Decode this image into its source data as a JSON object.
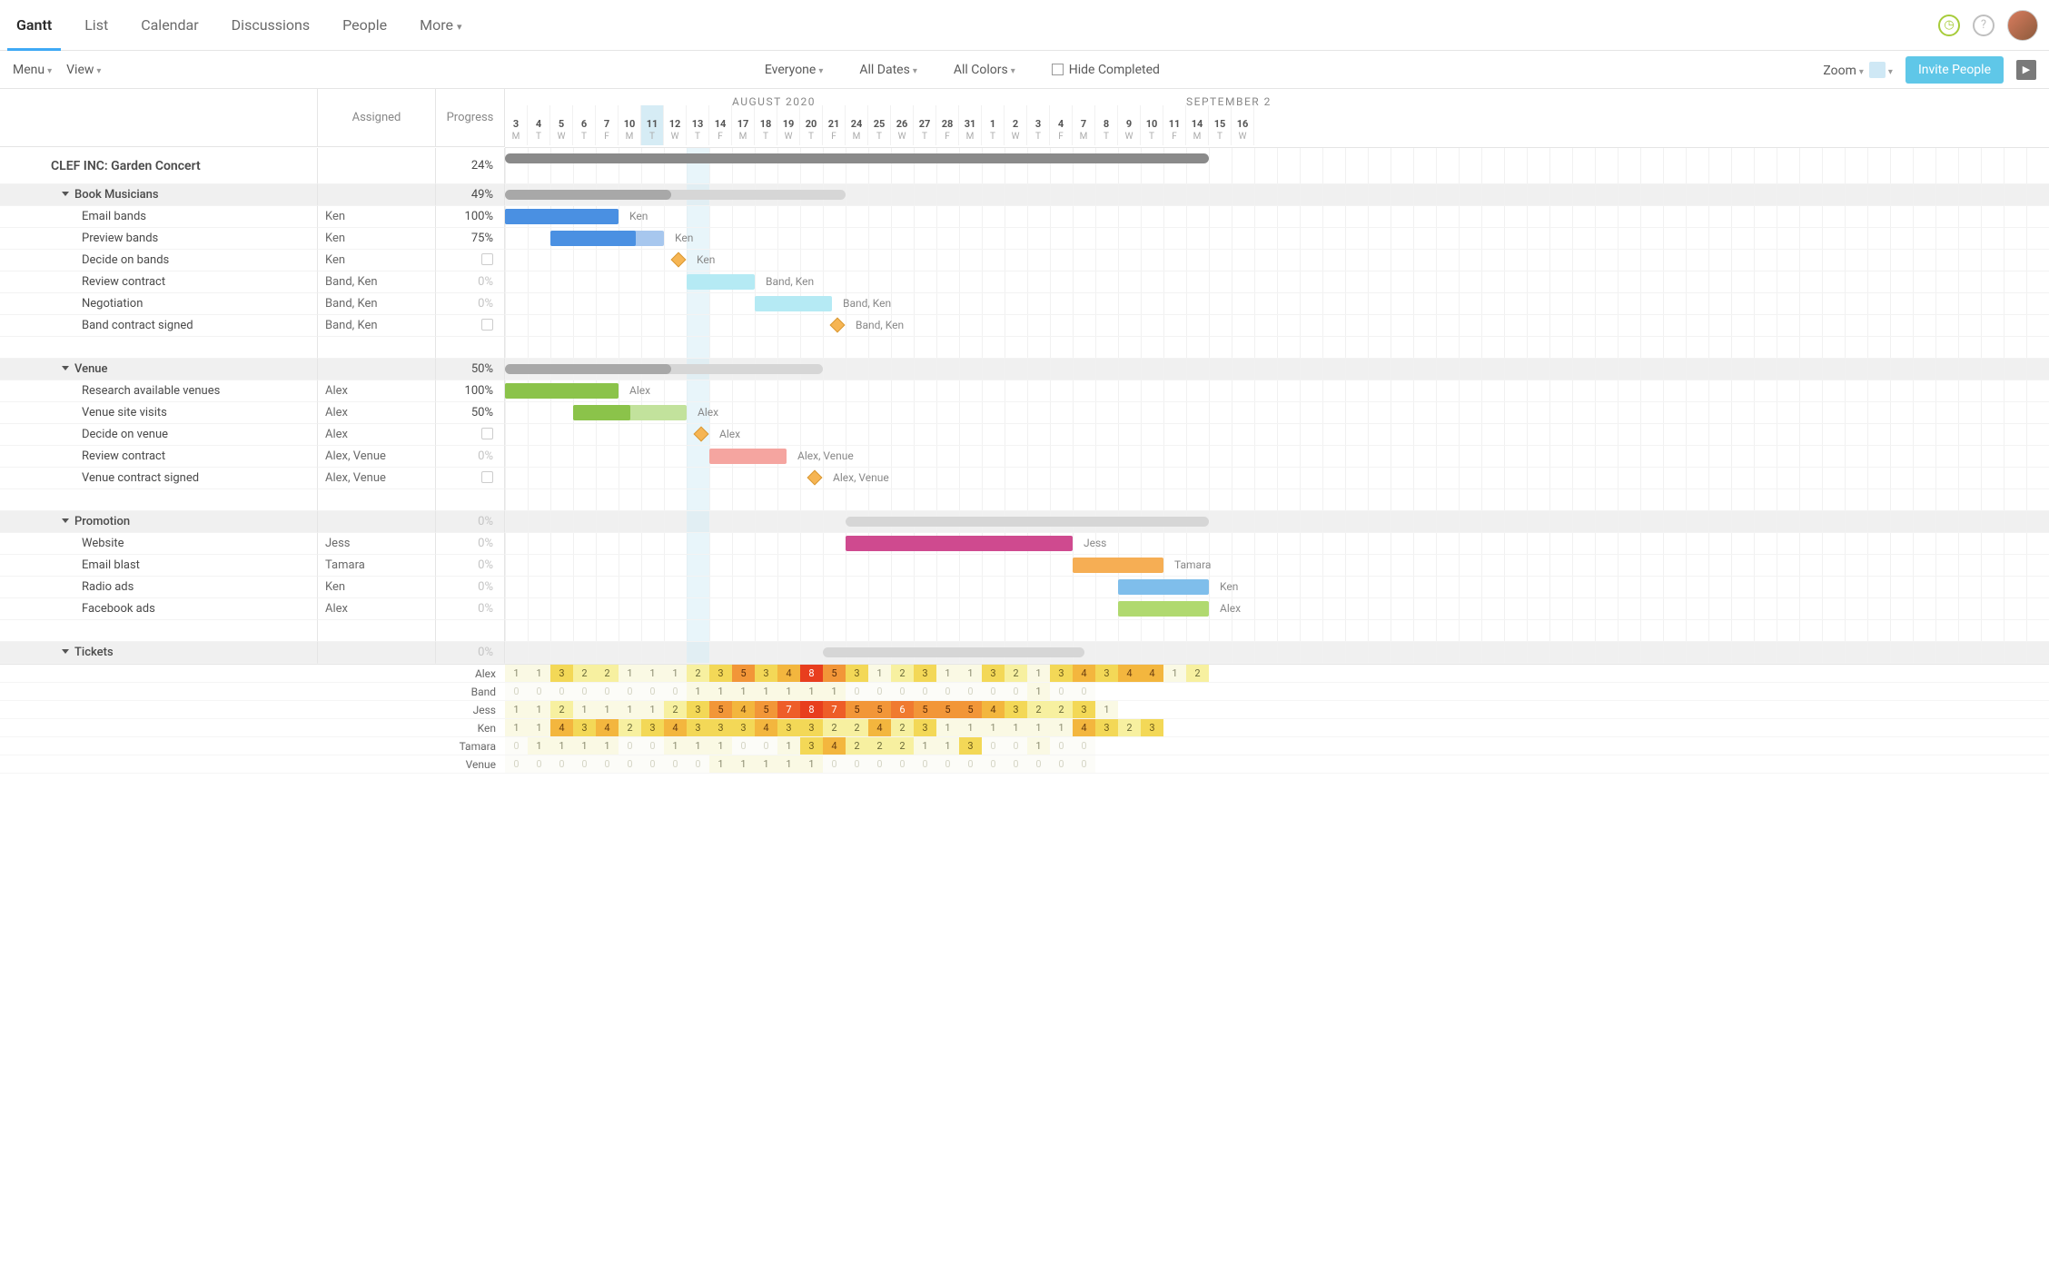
{
  "nav": {
    "tabs": [
      "Gantt",
      "List",
      "Calendar",
      "Discussions",
      "People",
      "More"
    ],
    "active": 0
  },
  "toolbar": {
    "menu": "Menu",
    "view": "View",
    "filters": {
      "people": "Everyone",
      "dates": "All Dates",
      "colors": "All Colors",
      "hide": "Hide Completed"
    },
    "zoom": "Zoom",
    "invite": "Invite People"
  },
  "columns": {
    "assigned": "Assigned",
    "progress": "Progress"
  },
  "timeline": {
    "month1": "AUGUST 2020",
    "month2": "SEPTEMBER 2",
    "start": 3,
    "today": 11,
    "days": [
      {
        "n": 3,
        "d": "M"
      },
      {
        "n": 4,
        "d": "T"
      },
      {
        "n": 5,
        "d": "W"
      },
      {
        "n": 6,
        "d": "T"
      },
      {
        "n": 7,
        "d": "F"
      },
      {
        "n": 10,
        "d": "M"
      },
      {
        "n": 11,
        "d": "T"
      },
      {
        "n": 12,
        "d": "W"
      },
      {
        "n": 13,
        "d": "T"
      },
      {
        "n": 14,
        "d": "F"
      },
      {
        "n": 17,
        "d": "M"
      },
      {
        "n": 18,
        "d": "T"
      },
      {
        "n": 19,
        "d": "W"
      },
      {
        "n": 20,
        "d": "T"
      },
      {
        "n": 21,
        "d": "F"
      },
      {
        "n": 24,
        "d": "M"
      },
      {
        "n": 25,
        "d": "T"
      },
      {
        "n": 26,
        "d": "W"
      },
      {
        "n": 27,
        "d": "T"
      },
      {
        "n": 28,
        "d": "F"
      },
      {
        "n": 31,
        "d": "M"
      },
      {
        "n": 1,
        "d": "T"
      },
      {
        "n": 2,
        "d": "W"
      },
      {
        "n": 3,
        "d": "T"
      },
      {
        "n": 4,
        "d": "F"
      },
      {
        "n": 7,
        "d": "M"
      },
      {
        "n": 8,
        "d": "T"
      },
      {
        "n": 9,
        "d": "W"
      },
      {
        "n": 10,
        "d": "T"
      },
      {
        "n": 11,
        "d": "F"
      },
      {
        "n": 14,
        "d": "M"
      },
      {
        "n": 15,
        "d": "T"
      },
      {
        "n": 16,
        "d": "W"
      }
    ]
  },
  "project": {
    "name": "CLEF INC: Garden Concert",
    "progress": "24%"
  },
  "groups": [
    {
      "name": "Book Musicians",
      "progress": "49%",
      "summary": {
        "start": 0,
        "len": 15,
        "done": 7.3
      },
      "tasks": [
        {
          "name": "Email bands",
          "assigned": "Ken",
          "progress": "100%",
          "bar": {
            "start": 0,
            "len": 5,
            "color": "blue",
            "done": 5
          },
          "label": "Ken"
        },
        {
          "name": "Preview bands",
          "assigned": "Ken",
          "progress": "75%",
          "bar": {
            "start": 2,
            "len": 5,
            "color": "blue",
            "done": 3.75
          },
          "label": "Ken"
        },
        {
          "name": "Decide on bands",
          "assigned": "Ken",
          "progress": "box",
          "milestone": {
            "at": 7.4
          },
          "label": "Ken"
        },
        {
          "name": "Review contract",
          "assigned": "Band, Ken",
          "progress": "0%",
          "muted": true,
          "bar": {
            "start": 8,
            "len": 3,
            "color": "cyan"
          },
          "label": "Band, Ken"
        },
        {
          "name": "Negotiation",
          "assigned": "Band, Ken",
          "progress": "0%",
          "muted": true,
          "bar": {
            "start": 11,
            "len": 3.4,
            "color": "cyan"
          },
          "label": "Band, Ken"
        },
        {
          "name": "Band contract signed",
          "assigned": "Band, Ken",
          "progress": "box",
          "milestone": {
            "at": 14.4
          },
          "label": "Band, Ken"
        }
      ]
    },
    {
      "name": "Venue",
      "progress": "50%",
      "summary": {
        "start": 0,
        "len": 14,
        "done": 7.3
      },
      "tasks": [
        {
          "name": "Research available venues",
          "assigned": "Alex",
          "progress": "100%",
          "bar": {
            "start": 0,
            "len": 5,
            "color": "green",
            "done": 5
          },
          "label": "Alex"
        },
        {
          "name": "Venue site visits",
          "assigned": "Alex",
          "progress": "50%",
          "bar": {
            "start": 3,
            "len": 5,
            "color": "green",
            "done": 2.5
          },
          "label": "Alex"
        },
        {
          "name": "Decide on venue",
          "assigned": "Alex",
          "progress": "box",
          "milestone": {
            "at": 8.4
          },
          "label": "Alex"
        },
        {
          "name": "Review contract",
          "assigned": "Alex, Venue",
          "progress": "0%",
          "muted": true,
          "bar": {
            "start": 9,
            "len": 3.4,
            "color": "red"
          },
          "label": "Alex, Venue"
        },
        {
          "name": "Venue contract signed",
          "assigned": "Alex, Venue",
          "progress": "box",
          "milestone": {
            "at": 13.4
          },
          "label": "Alex, Venue"
        }
      ]
    },
    {
      "name": "Promotion",
      "progress": "0%",
      "muted": true,
      "summary": {
        "start": 15,
        "len": 16,
        "done": 0
      },
      "tasks": [
        {
          "name": "Website",
          "assigned": "Jess",
          "progress": "0%",
          "muted": true,
          "bar": {
            "start": 15,
            "len": 10,
            "color": "pink"
          },
          "label": "Jess"
        },
        {
          "name": "Email blast",
          "assigned": "Tamara",
          "progress": "0%",
          "muted": true,
          "bar": {
            "start": 25,
            "len": 4,
            "color": "orange"
          },
          "label": "Tamara"
        },
        {
          "name": "Radio ads",
          "assigned": "Ken",
          "progress": "0%",
          "muted": true,
          "bar": {
            "start": 27,
            "len": 4,
            "color": "skyblue"
          },
          "label": "Ken"
        },
        {
          "name": "Facebook ads",
          "assigned": "Alex",
          "progress": "0%",
          "muted": true,
          "bar": {
            "start": 27,
            "len": 4,
            "color": "lime"
          },
          "label": "Alex"
        }
      ]
    },
    {
      "name": "Tickets",
      "progress": "0%",
      "muted": true,
      "summary": {
        "start": 14,
        "len": 11.5,
        "done": 0
      },
      "tasks": []
    }
  ],
  "workload": {
    "people": [
      "Alex",
      "Band",
      "Jess",
      "Ken",
      "Tamara",
      "Venue"
    ],
    "rows": [
      [
        1,
        1,
        3,
        2,
        2,
        1,
        1,
        1,
        2,
        3,
        5,
        3,
        4,
        8,
        5,
        3,
        1,
        2,
        3,
        1,
        1,
        3,
        2,
        1,
        3,
        4,
        3,
        4,
        4,
        1,
        2
      ],
      [
        0,
        0,
        0,
        0,
        0,
        0,
        0,
        0,
        1,
        1,
        1,
        1,
        1,
        1,
        1,
        0,
        0,
        0,
        0,
        0,
        0,
        0,
        0,
        1,
        0,
        0
      ],
      [
        1,
        1,
        2,
        1,
        1,
        1,
        1,
        2,
        3,
        5,
        4,
        5,
        7,
        8,
        7,
        5,
        5,
        6,
        5,
        5,
        5,
        4,
        3,
        2,
        2,
        3,
        1
      ],
      [
        1,
        1,
        4,
        3,
        4,
        2,
        3,
        4,
        3,
        3,
        3,
        4,
        3,
        3,
        2,
        2,
        4,
        2,
        3,
        1,
        1,
        1,
        1,
        1,
        1,
        4,
        3,
        2,
        3
      ],
      [
        0,
        1,
        1,
        1,
        1,
        0,
        0,
        1,
        1,
        1,
        0,
        0,
        1,
        3,
        4,
        2,
        2,
        2,
        1,
        1,
        3,
        0,
        0,
        1,
        0,
        0
      ],
      [
        0,
        0,
        0,
        0,
        0,
        0,
        0,
        0,
        0,
        1,
        1,
        1,
        1,
        1,
        0,
        0,
        0,
        0,
        0,
        0,
        0,
        0,
        0,
        0,
        0,
        0
      ]
    ]
  }
}
